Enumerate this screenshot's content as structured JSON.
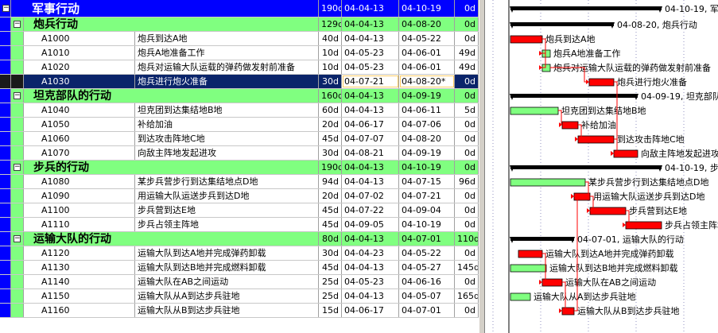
{
  "project": {
    "name": "军事行动",
    "duration": "190d",
    "start": "04-04-13",
    "end": "04-10-19",
    "float": "0d",
    "gantt_label": "04-10-19, 军事"
  },
  "groups": [
    {
      "name": "炮兵行动",
      "duration": "129d",
      "start": "04-04-13",
      "end": "04-08-20",
      "float": "0d",
      "gantt_label": "04-08-20, 炮兵行动",
      "tasks": [
        {
          "code": "A1000",
          "name": "炮兵到达A地",
          "duration": "40d",
          "start": "04-04-13",
          "end": "04-05-22",
          "float": "0d",
          "critical": true
        },
        {
          "code": "A1010",
          "name": "炮兵A地准备工作",
          "duration": "10d",
          "start": "04-05-23",
          "end": "04-06-01",
          "float": "49d",
          "critical": false
        },
        {
          "code": "A1020",
          "name": "炮兵对运输大队运载的弹药做发射前准备",
          "duration": "10d",
          "start": "04-05-23",
          "end": "04-06-01",
          "float": "49d",
          "critical": false
        },
        {
          "code": "A1030",
          "name": "炮兵进行炮火准备",
          "duration": "30d",
          "start": "04-07-21",
          "end": "04-08-20*",
          "float": "0d",
          "critical": true,
          "selected": true
        }
      ]
    },
    {
      "name": "坦克部队的行动",
      "duration": "160d",
      "start": "04-04-13",
      "end": "04-09-19",
      "float": "0d",
      "gantt_label": "04-09-19, 坦克部队",
      "tasks": [
        {
          "code": "A1040",
          "name": "坦克团到达集结地B地",
          "duration": "60d",
          "start": "04-04-13",
          "end": "04-06-11",
          "float": "5d",
          "critical": false
        },
        {
          "code": "A1050",
          "name": "补给加油",
          "duration": "20d",
          "start": "04-06-17",
          "end": "04-07-06",
          "float": "0d",
          "critical": true
        },
        {
          "code": "A1060",
          "name": "到达攻击阵地C地",
          "duration": "45d",
          "start": "04-07-07",
          "end": "04-08-20",
          "float": "0d",
          "critical": true
        },
        {
          "code": "A1070",
          "name": "向敌主阵地发起进攻",
          "duration": "30d",
          "start": "04-08-21",
          "end": "04-09-19",
          "float": "0d",
          "critical": true
        }
      ]
    },
    {
      "name": "步兵的行动",
      "duration": "190d",
      "start": "04-04-13",
      "end": "04-10-19",
      "float": "0d",
      "gantt_label": "04-10-19, 步兵",
      "tasks": [
        {
          "code": "A1080",
          "name": "某步兵营步行到达集结地点D地",
          "duration": "94d",
          "start": "04-04-13",
          "end": "04-07-15",
          "float": "96d",
          "critical": false
        },
        {
          "code": "A1090",
          "name": "用运输大队运送步兵到达D地",
          "duration": "20d",
          "start": "04-07-02",
          "end": "04-07-21",
          "float": "0d",
          "critical": true
        },
        {
          "code": "A1100",
          "name": "步兵营到达E地",
          "duration": "45d",
          "start": "04-07-22",
          "end": "04-09-04",
          "float": "0d",
          "critical": true
        },
        {
          "code": "A1110",
          "name": "步兵占领主阵地",
          "duration": "45d",
          "start": "04-09-05",
          "end": "04-10-19",
          "float": "0d",
          "critical": true
        }
      ]
    },
    {
      "name": "运输大队的行动",
      "duration": "80d",
      "start": "04-04-13",
      "end": "04-07-01",
      "float": "110d",
      "gantt_label": "04-07-01, 运输大队的行动",
      "tasks": [
        {
          "code": "A1120",
          "name": "运输大队到达A地并完成弹药卸载",
          "duration": "30d",
          "start": "04-04-23",
          "end": "04-05-22",
          "float": "0d",
          "critical": true
        },
        {
          "code": "A1130",
          "name": "运输大队到达B地并完成燃料卸载",
          "duration": "45d",
          "start": "04-04-13",
          "end": "04-05-27",
          "float": "145d",
          "critical": false
        },
        {
          "code": "A1140",
          "name": "运输大队在AB之间运动",
          "duration": "25d",
          "start": "04-05-23",
          "end": "04-06-16",
          "float": "0d",
          "critical": true
        },
        {
          "code": "A1150",
          "name": "运输大队从A到达步兵驻地",
          "duration": "25d",
          "start": "04-04-13",
          "end": "04-05-07",
          "float": "165d",
          "critical": false
        },
        {
          "code": "A1160",
          "name": "运输大队从B到达步兵驻地",
          "duration": "15d",
          "start": "04-06-17",
          "end": "04-07-01",
          "float": "0d",
          "critical": true
        }
      ]
    }
  ],
  "colors": {
    "project_row": "#0000ff",
    "summary_row": "#80ff80",
    "selected_row": "#0a246a",
    "critical_bar": "#ff0000",
    "normal_bar": "#80ff80",
    "summary_bar": "#000000",
    "link_line": "#ff0000"
  },
  "icons": {
    "expand": "minus-box-icon"
  }
}
